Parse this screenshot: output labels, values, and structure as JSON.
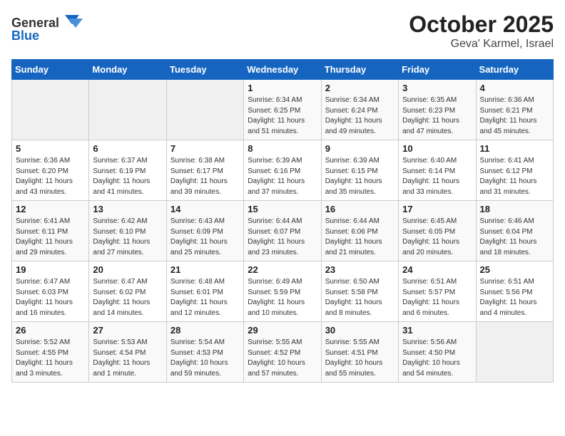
{
  "header": {
    "logo_general": "General",
    "logo_blue": "Blue",
    "month": "October 2025",
    "location": "Geva' Karmel, Israel"
  },
  "days_of_week": [
    "Sunday",
    "Monday",
    "Tuesday",
    "Wednesday",
    "Thursday",
    "Friday",
    "Saturday"
  ],
  "weeks": [
    [
      {
        "day": "",
        "info": ""
      },
      {
        "day": "",
        "info": ""
      },
      {
        "day": "",
        "info": ""
      },
      {
        "day": "1",
        "info": "Sunrise: 6:34 AM\nSunset: 6:25 PM\nDaylight: 11 hours\nand 51 minutes."
      },
      {
        "day": "2",
        "info": "Sunrise: 6:34 AM\nSunset: 6:24 PM\nDaylight: 11 hours\nand 49 minutes."
      },
      {
        "day": "3",
        "info": "Sunrise: 6:35 AM\nSunset: 6:23 PM\nDaylight: 11 hours\nand 47 minutes."
      },
      {
        "day": "4",
        "info": "Sunrise: 6:36 AM\nSunset: 6:21 PM\nDaylight: 11 hours\nand 45 minutes."
      }
    ],
    [
      {
        "day": "5",
        "info": "Sunrise: 6:36 AM\nSunset: 6:20 PM\nDaylight: 11 hours\nand 43 minutes."
      },
      {
        "day": "6",
        "info": "Sunrise: 6:37 AM\nSunset: 6:19 PM\nDaylight: 11 hours\nand 41 minutes."
      },
      {
        "day": "7",
        "info": "Sunrise: 6:38 AM\nSunset: 6:17 PM\nDaylight: 11 hours\nand 39 minutes."
      },
      {
        "day": "8",
        "info": "Sunrise: 6:39 AM\nSunset: 6:16 PM\nDaylight: 11 hours\nand 37 minutes."
      },
      {
        "day": "9",
        "info": "Sunrise: 6:39 AM\nSunset: 6:15 PM\nDaylight: 11 hours\nand 35 minutes."
      },
      {
        "day": "10",
        "info": "Sunrise: 6:40 AM\nSunset: 6:14 PM\nDaylight: 11 hours\nand 33 minutes."
      },
      {
        "day": "11",
        "info": "Sunrise: 6:41 AM\nSunset: 6:12 PM\nDaylight: 11 hours\nand 31 minutes."
      }
    ],
    [
      {
        "day": "12",
        "info": "Sunrise: 6:41 AM\nSunset: 6:11 PM\nDaylight: 11 hours\nand 29 minutes."
      },
      {
        "day": "13",
        "info": "Sunrise: 6:42 AM\nSunset: 6:10 PM\nDaylight: 11 hours\nand 27 minutes."
      },
      {
        "day": "14",
        "info": "Sunrise: 6:43 AM\nSunset: 6:09 PM\nDaylight: 11 hours\nand 25 minutes."
      },
      {
        "day": "15",
        "info": "Sunrise: 6:44 AM\nSunset: 6:07 PM\nDaylight: 11 hours\nand 23 minutes."
      },
      {
        "day": "16",
        "info": "Sunrise: 6:44 AM\nSunset: 6:06 PM\nDaylight: 11 hours\nand 21 minutes."
      },
      {
        "day": "17",
        "info": "Sunrise: 6:45 AM\nSunset: 6:05 PM\nDaylight: 11 hours\nand 20 minutes."
      },
      {
        "day": "18",
        "info": "Sunrise: 6:46 AM\nSunset: 6:04 PM\nDaylight: 11 hours\nand 18 minutes."
      }
    ],
    [
      {
        "day": "19",
        "info": "Sunrise: 6:47 AM\nSunset: 6:03 PM\nDaylight: 11 hours\nand 16 minutes."
      },
      {
        "day": "20",
        "info": "Sunrise: 6:47 AM\nSunset: 6:02 PM\nDaylight: 11 hours\nand 14 minutes."
      },
      {
        "day": "21",
        "info": "Sunrise: 6:48 AM\nSunset: 6:01 PM\nDaylight: 11 hours\nand 12 minutes."
      },
      {
        "day": "22",
        "info": "Sunrise: 6:49 AM\nSunset: 5:59 PM\nDaylight: 11 hours\nand 10 minutes."
      },
      {
        "day": "23",
        "info": "Sunrise: 6:50 AM\nSunset: 5:58 PM\nDaylight: 11 hours\nand 8 minutes."
      },
      {
        "day": "24",
        "info": "Sunrise: 6:51 AM\nSunset: 5:57 PM\nDaylight: 11 hours\nand 6 minutes."
      },
      {
        "day": "25",
        "info": "Sunrise: 6:51 AM\nSunset: 5:56 PM\nDaylight: 11 hours\nand 4 minutes."
      }
    ],
    [
      {
        "day": "26",
        "info": "Sunrise: 5:52 AM\nSunset: 4:55 PM\nDaylight: 11 hours\nand 3 minutes."
      },
      {
        "day": "27",
        "info": "Sunrise: 5:53 AM\nSunset: 4:54 PM\nDaylight: 11 hours\nand 1 minute."
      },
      {
        "day": "28",
        "info": "Sunrise: 5:54 AM\nSunset: 4:53 PM\nDaylight: 10 hours\nand 59 minutes."
      },
      {
        "day": "29",
        "info": "Sunrise: 5:55 AM\nSunset: 4:52 PM\nDaylight: 10 hours\nand 57 minutes."
      },
      {
        "day": "30",
        "info": "Sunrise: 5:55 AM\nSunset: 4:51 PM\nDaylight: 10 hours\nand 55 minutes."
      },
      {
        "day": "31",
        "info": "Sunrise: 5:56 AM\nSunset: 4:50 PM\nDaylight: 10 hours\nand 54 minutes."
      },
      {
        "day": "",
        "info": ""
      }
    ]
  ]
}
